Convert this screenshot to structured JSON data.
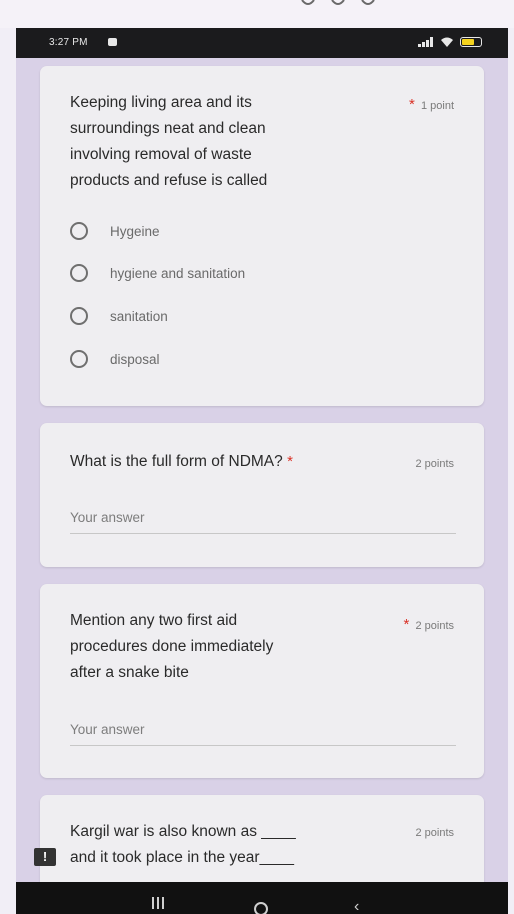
{
  "status_bar": {
    "time": "3:27 PM",
    "icons": [
      "notification-icon",
      "signal-icon",
      "wifi-icon",
      "battery-icon"
    ]
  },
  "questions": [
    {
      "lines": [
        "Keeping living area and its",
        "surroundings neat and clean",
        "involving removal of waste",
        "products and refuse is called"
      ],
      "required_mark": "*",
      "points": "1 point",
      "options": [
        "Hygeine",
        "hygiene and sanitation",
        "sanitation",
        "disposal"
      ]
    },
    {
      "lines": [
        "What is the full form of NDMA?"
      ],
      "required_mark": "*",
      "points": "2 points",
      "answer_placeholder": "Your answer"
    },
    {
      "lines": [
        "Mention any two first aid",
        "procedures done immediately",
        "after a snake bite"
      ],
      "required_mark": "*",
      "points": "2 points",
      "answer_placeholder": "Your answer"
    },
    {
      "lines": [
        "Kargil war is also known as ____",
        "and it took place in the year____"
      ],
      "points": "2 points"
    }
  ],
  "feedback_icon_glyph": "!",
  "nav_bar": {
    "icons": [
      "recents-icon",
      "home-icon",
      "back-icon"
    ]
  },
  "colors": {
    "background": "#d9d1e7",
    "card": "#efeef1",
    "required": "#d93025",
    "status_bar": "#1b1b1d"
  }
}
